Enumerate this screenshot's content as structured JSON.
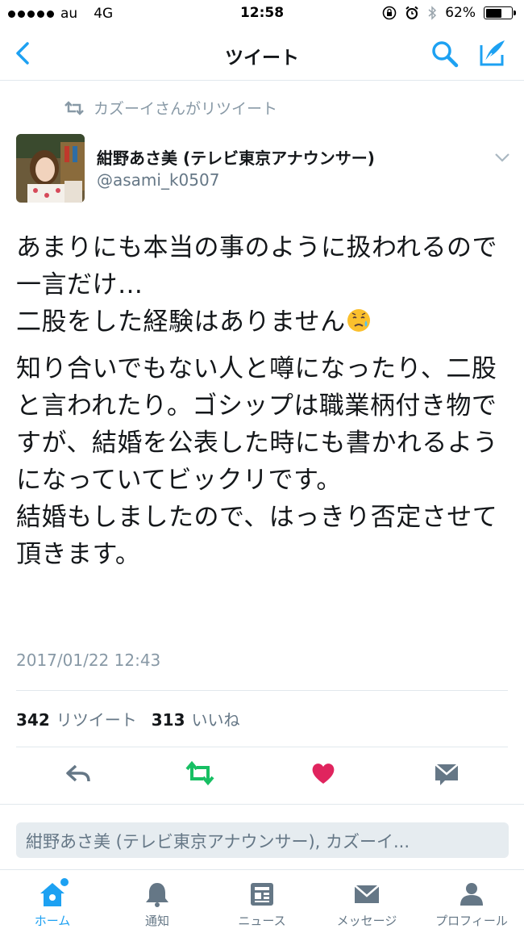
{
  "status_bar": {
    "carrier": "au",
    "network": "4G",
    "time": "12:58",
    "battery": "62%",
    "battery_level": 0.62
  },
  "nav": {
    "title": "ツイート"
  },
  "retweet": {
    "text": "カズーイさんがリツイート"
  },
  "author": {
    "name": "紺野あさ美 (テレビ東京アナウンサー)",
    "handle": "@asami_k0507"
  },
  "tweet": {
    "paragraph1": "あまりにも本当の事のように扱われるので一言だけ…\n二股をした経験はありません",
    "paragraph2": "知り合いでもない人と噂になったり、二股と言われたり。ゴシップは職業柄付き物ですが、結婚を公表した時にも書かれるようになっていてビックリです。\n結婚もしましたので、はっきり否定させて頂きます。",
    "timestamp": "2017/01/22 12:43"
  },
  "stats": {
    "retweets": "342",
    "retweets_label": "リツイート",
    "likes": "313",
    "likes_label": "いいね"
  },
  "reply": {
    "placeholder": "紺野あさ美 (テレビ東京アナウンサー), カズーイ..."
  },
  "tabs": [
    {
      "label": "ホーム",
      "icon": "home-icon",
      "active": true
    },
    {
      "label": "通知",
      "icon": "bell-icon"
    },
    {
      "label": "ニュース",
      "icon": "news-icon"
    },
    {
      "label": "メッセージ",
      "icon": "envelope-icon"
    },
    {
      "label": "プロフィール",
      "icon": "person-icon"
    }
  ],
  "colors": {
    "accent": "#1da1f2",
    "retweet_green": "#17bf63",
    "like_red": "#e0245e",
    "muted": "#8899a6"
  }
}
